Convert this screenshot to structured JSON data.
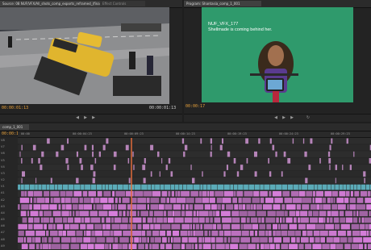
{
  "source_monitor": {
    "tab_label": "Source: 08 NUF/VFX/All_shots_comp_exports_reframed_(final) 03_003",
    "tab2_label": "Effect Controls",
    "timecode_in": "00:00:01:13",
    "timecode_out": "00:00:01:13"
  },
  "program_monitor": {
    "tab_label": "Program: Shantasia_comp_1_001",
    "timecode": "00:00:17",
    "overlay_line1": "NUF_VFX_177",
    "overlay_line2": "Shellmade is coming behind her."
  },
  "timeline": {
    "tab_label": "comp_1_001",
    "timecode": "00:00:17",
    "ruler_labels": [
      "00:00",
      "00:00:04:23",
      "00:00:09:23",
      "00:00:14:23",
      "00:00:19:23",
      "00:00:24:23",
      "00:00:29:23"
    ],
    "tracks": [
      "V8",
      "V7",
      "V6",
      "V5",
      "V4",
      "V3",
      "V2",
      "V1",
      "A1",
      "A2",
      "A3",
      "A4",
      "A5",
      "A6",
      "A7",
      "A8",
      "A9"
    ]
  },
  "colors": {
    "accent": "#e8a13a",
    "clip_video": "#c58ec9",
    "clip_audio": "#d87fdc",
    "clip_cyan": "#61b9c8",
    "playhead": "#e06a3a",
    "green_screen": "#2f9a6c"
  },
  "icons": [
    "play-icon",
    "step-back-icon",
    "step-forward-icon",
    "loop-icon",
    "snap-icon"
  ]
}
